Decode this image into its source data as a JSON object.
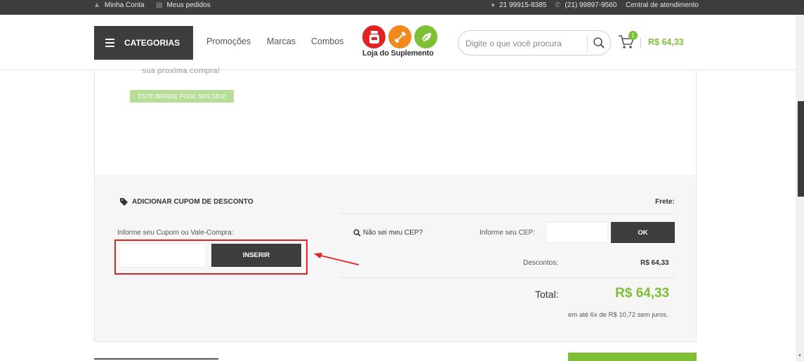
{
  "topbar": {
    "account": "Minha Conta",
    "orders": "Meus pedidos",
    "whatsapp": "21 99915-8385",
    "phone": "(21) 99897-9560",
    "service": "Central de atendimento"
  },
  "header": {
    "categories_label": "CATEGORIAS",
    "nav": [
      "Promoções",
      "Marcas",
      "Combos"
    ],
    "logo_text": "Loja do Suplemento",
    "search_placeholder": "Digite o que você procura",
    "cart_count": "1",
    "cart_total": "R$ 64,33"
  },
  "gift": {
    "text": "sua proxima compra!",
    "tag": "ESTE BRINDE PODE SER SEU!"
  },
  "coupon": {
    "title": "ADICIONAR CUPOM DE DESCONTO",
    "label": "Informe seu Cupom ou Vale-Compra:",
    "button": "INSERIR"
  },
  "shipping": {
    "title": "Frete:",
    "no_cep": "Não sei meu CEP?",
    "cep_label": "Informe seu CEP:",
    "ok_button": "OK"
  },
  "summary": {
    "discount_label": "Descontos:",
    "discount_value": "R$ 64,33",
    "total_label": "Total:",
    "total_value": "R$ 64,33",
    "installments": "em até 6x de R$ 10,72 sem juros."
  },
  "colors": {
    "accent_green": "#7fbf36",
    "dark": "#3d3d3d",
    "highlight_red": "#e02424"
  },
  "icons": {
    "logo_left": "supplement-jar-icon",
    "logo_middle": "dumbbell-icon",
    "logo_right": "leaf-icon"
  }
}
